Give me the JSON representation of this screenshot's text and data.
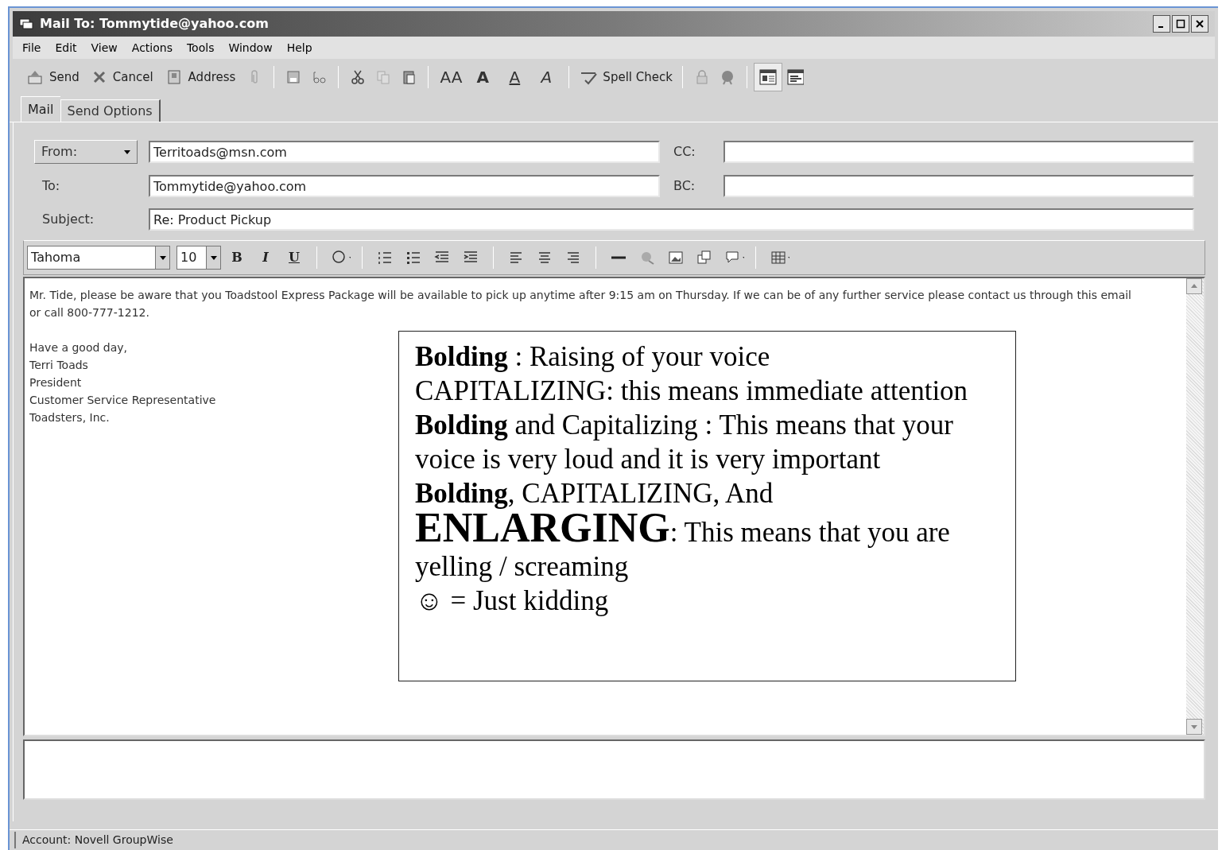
{
  "window": {
    "title": "Mail To: Tommytide@yahoo.com"
  },
  "menu": [
    "File",
    "Edit",
    "View",
    "Actions",
    "Tools",
    "Window",
    "Help"
  ],
  "toolbar": {
    "send": "Send",
    "cancel": "Cancel",
    "address": "Address",
    "font_letters": [
      "AA",
      "A",
      "A",
      "A"
    ],
    "spell_check": "Spell Check"
  },
  "tabs": [
    {
      "label": "Mail",
      "selected": true
    },
    {
      "label": "Send Options",
      "selected": false
    }
  ],
  "fields": {
    "from_label": "From:",
    "from": "Territoads@msn.com",
    "to_label": "To:",
    "to": "Tommytide@yahoo.com",
    "subject_label": "Subject:",
    "subject": "Re: Product Pickup",
    "cc_label": "CC:",
    "bc_label": "BC:"
  },
  "format_bar": {
    "font": "Tahoma",
    "size": "10",
    "bold": "B",
    "italic": "I",
    "underline": "U"
  },
  "body": {
    "paragraphs": [
      "Mr. Tide, please be aware that you Toadstool Express Package will be available to pick up anytime after 9:15 am on Thursday. If we can be of any further service please contact us through this email or call 800-777-1212."
    ],
    "signature": [
      "Have a good day,",
      "Terri Toads",
      "President",
      "Customer Service Representative",
      "Toadsters, Inc."
    ]
  },
  "note": [
    [
      {
        "text": "**Bolding** : Raising of your voice",
        "large": false
      }
    ],
    [
      {
        "text": "CAPITALIZING: this means immediate attention",
        "large": false
      }
    ],
    [
      {
        "text": "**Bolding** and Capitalizing : This means that your voice is very loud and it is very important",
        "large": false
      }
    ],
    [
      {
        "text": "**Bolding**, CAPITALIZING, And ",
        "large": false
      },
      {
        "text": "**ENLARGING**",
        "large": true
      },
      {
        "text": ": This means that you are yelling / screaming",
        "large": false
      }
    ],
    [
      {
        "text": "☺ = Just kidding",
        "large": false
      }
    ]
  ],
  "status_bar": "Account: Novell GroupWise"
}
